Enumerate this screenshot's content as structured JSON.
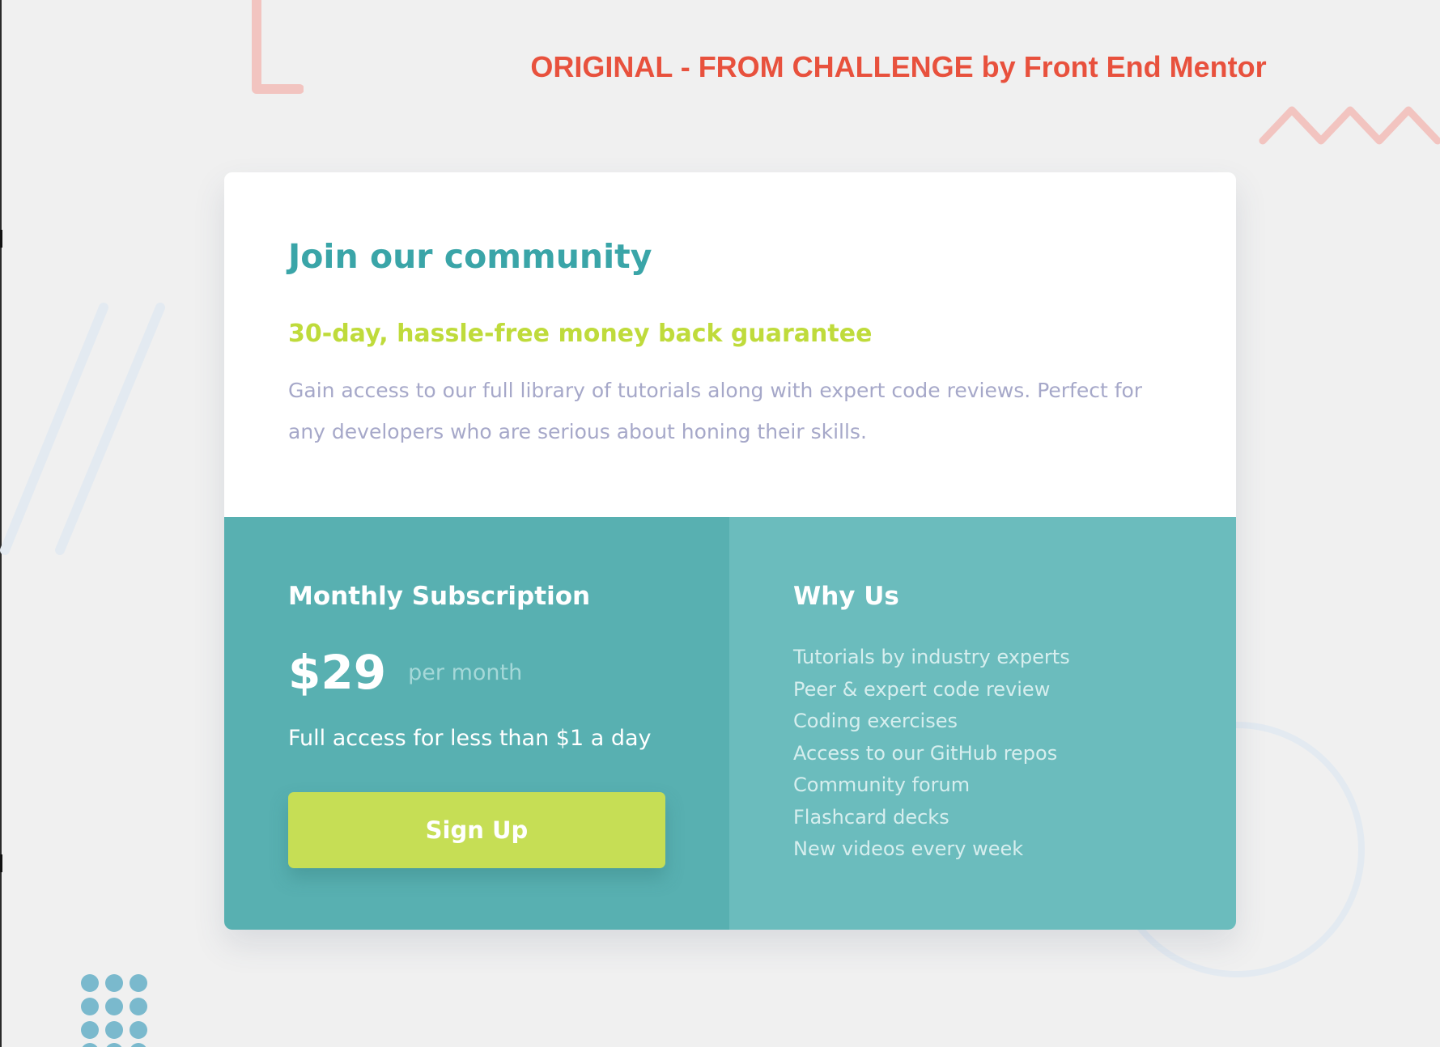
{
  "banner": "ORIGINAL - FROM CHALLENGE by Front End Mentor",
  "colors": {
    "background": "#f0f0f0",
    "banner": "#e8513d",
    "heading": "#3aa5a8",
    "guarantee": "#bfdb3b",
    "description": "#a6a8c9",
    "subscription_panel": "#58b0b1",
    "why_us_panel": "#6bbcbd",
    "button": "#c6de55",
    "decoration_pink": "#f2c4c0",
    "decoration_blue": "#e3eaf1",
    "dots": "#7ab9cd"
  },
  "card": {
    "title": "Join our community",
    "subtitle": "30-day, hassle-free money back guarantee",
    "description": "Gain access to our full library of tutorials along with expert code reviews. Perfect for any developers who are serious about honing their skills."
  },
  "subscription": {
    "heading": "Monthly Subscription",
    "price": "$29",
    "period": "per month",
    "tagline": "Full access for less than $1 a day",
    "button_label": "Sign Up"
  },
  "why_us": {
    "heading": "Why Us",
    "items": [
      "Tutorials by industry experts",
      "Peer & expert code review",
      "Coding exercises",
      "Access to our GitHub repos",
      "Community forum",
      "Flashcard decks",
      "New videos every week"
    ]
  },
  "decorations": {
    "corner_bracket": "bracket-shape",
    "zigzag": "zigzag-shape",
    "slashes": "diagonal-lines",
    "circle": "ring-shape",
    "dots": "dot-grid"
  }
}
